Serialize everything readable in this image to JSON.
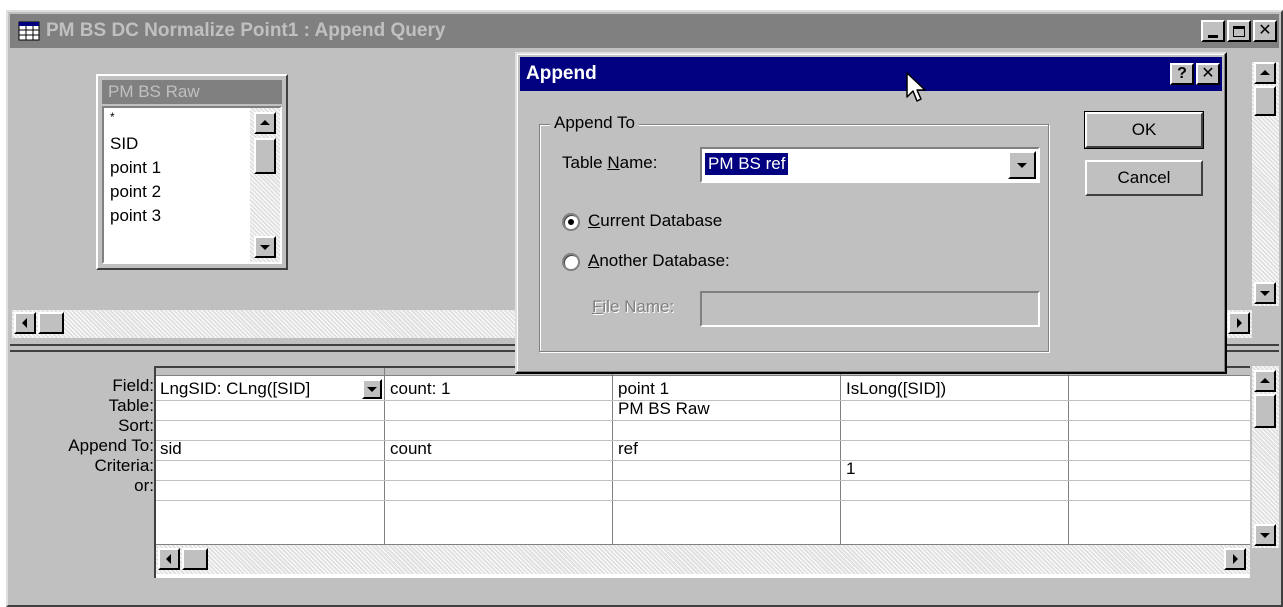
{
  "window": {
    "title": "PM BS DC Normalize Point1 : Append Query"
  },
  "table_box": {
    "title": "PM BS Raw",
    "fields": [
      "*",
      "SID",
      "point 1",
      "point 2",
      "point 3"
    ]
  },
  "grid": {
    "row_labels": [
      "Field:",
      "Table:",
      "Sort:",
      "Append To:",
      "Criteria:",
      "or:"
    ],
    "columns": [
      {
        "field": "LngSID: CLng([SID]",
        "table": "",
        "sort": "",
        "append_to": "sid",
        "criteria": "",
        "or": ""
      },
      {
        "field": "count: 1",
        "table": "",
        "sort": "",
        "append_to": "count",
        "criteria": "",
        "or": ""
      },
      {
        "field": "point 1",
        "table": "PM BS Raw",
        "sort": "",
        "append_to": "ref",
        "criteria": "",
        "or": ""
      },
      {
        "field": "IsLong([SID])",
        "table": "",
        "sort": "",
        "append_to": "",
        "criteria": "1",
        "or": ""
      },
      {
        "field": "",
        "table": "",
        "sort": "",
        "append_to": "",
        "criteria": "",
        "or": ""
      }
    ]
  },
  "dialog": {
    "title": "Append",
    "help_glyph": "?",
    "close_glyph": "✕",
    "group_label": "Append To",
    "table_name_label_pre": "Table ",
    "table_name_label_key": "N",
    "table_name_label_post": "ame:",
    "table_name_value": "PM BS ref",
    "current_db_key": "C",
    "current_db_rest": "urrent Database",
    "current_db_selected": true,
    "another_db_key": "A",
    "another_db_rest": "nother Database:",
    "file_name_key": "F",
    "file_name_rest": "ile Name:",
    "file_name_value": "",
    "ok_label": "OK",
    "cancel_label": "Cancel"
  },
  "colors": {
    "face": "#c0c0c0",
    "active_title": "#000080",
    "inactive_title": "#808080",
    "selection": "#000080"
  }
}
